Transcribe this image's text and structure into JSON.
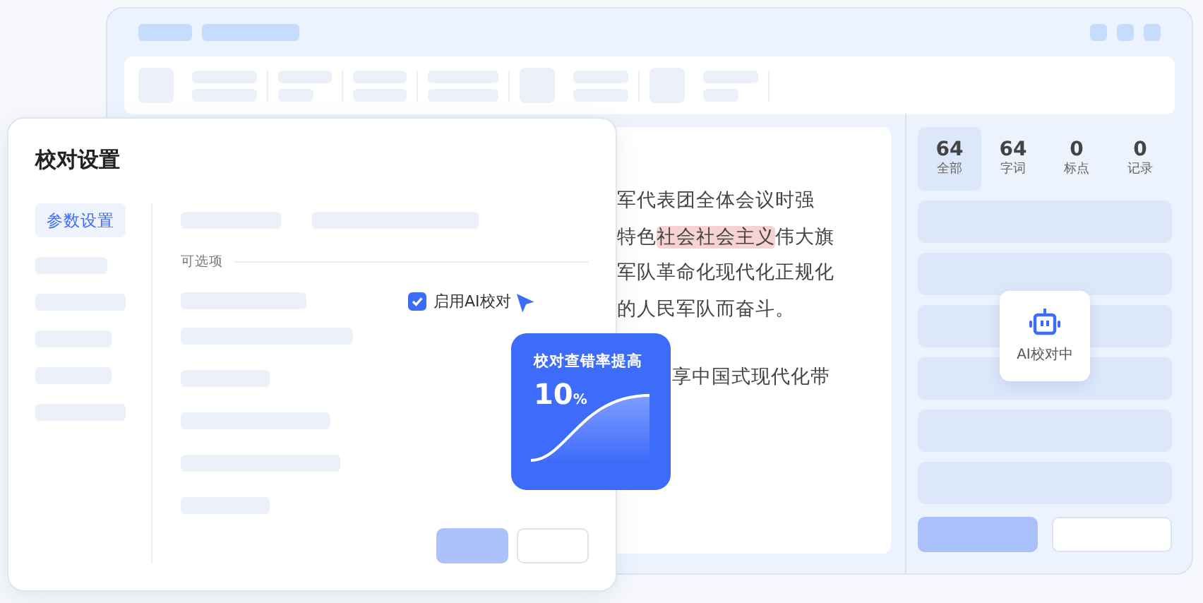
{
  "app": {
    "doc_lines": [
      {
        "segments": [
          {
            "text": "军代表团全体会议时强",
            "highlighted": false
          }
        ]
      },
      {
        "segments": [
          {
            "text": "特色",
            "highlighted": false
          },
          {
            "text": "社会社会主义",
            "highlighted": true
          },
          {
            "text": "伟大旗",
            "highlighted": false
          }
        ]
      },
      {
        "segments": [
          {
            "text": "军队革命化现代化正规化",
            "highlighted": false
          }
        ]
      },
      {
        "segments": [
          {
            "text": "的人民军队而奋斗。",
            "highlighted": false
          }
        ]
      },
      {
        "segments": [
          {
            "text": "享中国式现代化带",
            "highlighted": false
          }
        ],
        "kind": "partial"
      }
    ],
    "stats": [
      {
        "value": "64",
        "label": "全部",
        "selected": true
      },
      {
        "value": "64",
        "label": "字词",
        "selected": false
      },
      {
        "value": "0",
        "label": "标点",
        "selected": false
      },
      {
        "value": "0",
        "label": "记录",
        "selected": false
      }
    ],
    "ai_status": "AI校对中"
  },
  "dialog": {
    "title": "校对设置",
    "nav": [
      {
        "label": "参数设置",
        "selected": true
      }
    ],
    "section_label": "可选项",
    "option": {
      "label": "启用AI校对",
      "checked": true
    }
  },
  "promo": {
    "title": "校对查错率提高",
    "value": "10",
    "unit": "%"
  }
}
